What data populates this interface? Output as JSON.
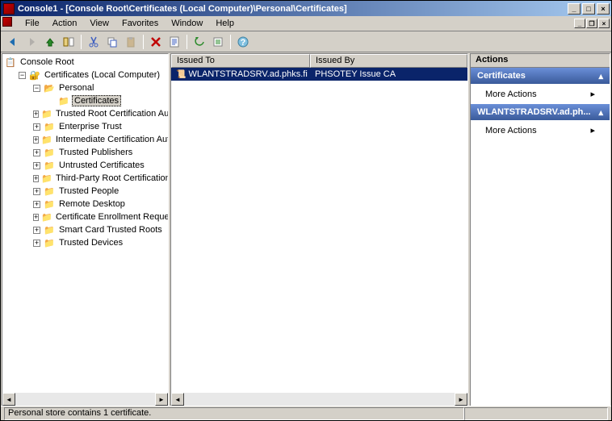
{
  "window": {
    "title": "Console1 - [Console Root\\Certificates (Local Computer)\\Personal\\Certificates]"
  },
  "menu": {
    "file": "File",
    "action": "Action",
    "view": "View",
    "favorites": "Favorites",
    "window": "Window",
    "help": "Help"
  },
  "tree": {
    "root": "Console Root",
    "cert_local": "Certificates (Local Computer)",
    "personal": "Personal",
    "certificates": "Certificates",
    "trusted_root": "Trusted Root Certification Authorities",
    "enterprise_trust": "Enterprise Trust",
    "intermediate": "Intermediate Certification Authorities",
    "trusted_publishers": "Trusted Publishers",
    "untrusted": "Untrusted Certificates",
    "third_party": "Third-Party Root Certification Authorities",
    "trusted_people": "Trusted People",
    "remote_desktop": "Remote Desktop",
    "cert_enrollment": "Certificate Enrollment Requests",
    "smart_card": "Smart Card Trusted Roots",
    "trusted_devices": "Trusted Devices"
  },
  "list": {
    "columns": {
      "issued_to": "Issued To",
      "issued_by": "Issued By"
    },
    "rows": [
      {
        "issued_to": "WLANTSTRADSRV.ad.phks.fi",
        "issued_by": "PHSOTEY Issue CA"
      }
    ]
  },
  "actions": {
    "title": "Actions",
    "section1": "Certificates",
    "more1": "More Actions",
    "section2": "WLANTSTRADSRV.ad.ph...",
    "more2": "More Actions"
  },
  "status": {
    "text": "Personal store contains 1 certificate."
  }
}
